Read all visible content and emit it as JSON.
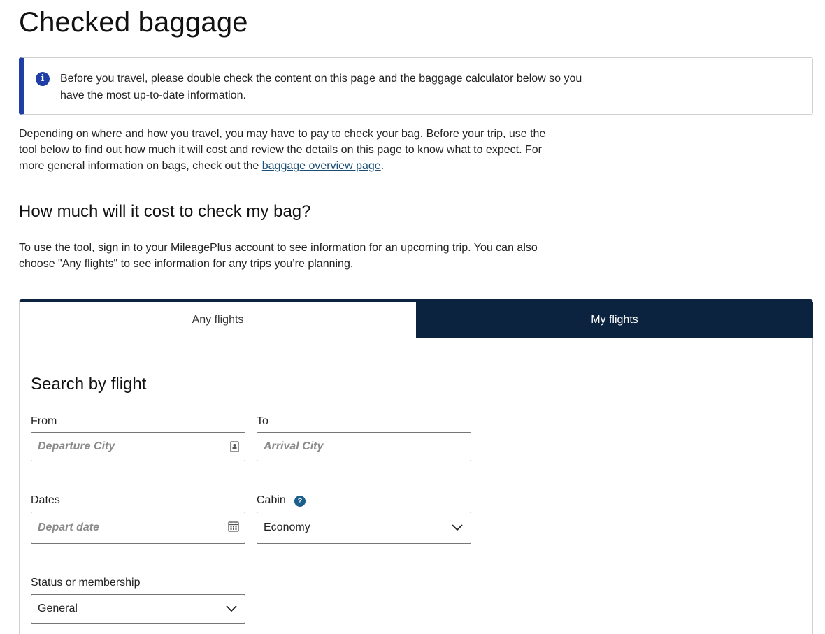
{
  "page": {
    "title": "Checked baggage"
  },
  "info_banner": {
    "text": "Before you travel, please double check the content on this page and the baggage calculator below so you have the most up-to-date information.",
    "accent_color": "#1f3ea6"
  },
  "intro": {
    "text_before_link": "Depending on where and how you travel, you may have to pay to check your bag. Before your trip, use the tool below to find out how much it will cost and review the details on this page to know what to expect. For more general information on bags, check out the ",
    "link_text": "baggage overview page",
    "text_after_link": "."
  },
  "cost_section": {
    "title": "How much will it cost to check my bag?",
    "description": "To use the tool, sign in to your MileagePlus account to see information for an upcoming trip. You can also choose \"Any flights\" to see information for any trips you’re planning."
  },
  "tabs": [
    {
      "label": "Any flights",
      "active": true
    },
    {
      "label": "My flights",
      "active": false
    }
  ],
  "form": {
    "title": "Search by flight",
    "from": {
      "label": "From",
      "placeholder": "Departure City",
      "icon": "address-book-icon"
    },
    "to": {
      "label": "To",
      "placeholder": "Arrival City"
    },
    "dates": {
      "label": "Dates",
      "placeholder": "Depart date",
      "icon": "calendar-icon"
    },
    "cabin": {
      "label": "Cabin",
      "value": "Economy",
      "help_icon": "question-mark-icon"
    },
    "status": {
      "label": "Status or membership",
      "value": "General"
    }
  },
  "colors": {
    "navy": "#0c2340",
    "link": "#1b4e74"
  }
}
